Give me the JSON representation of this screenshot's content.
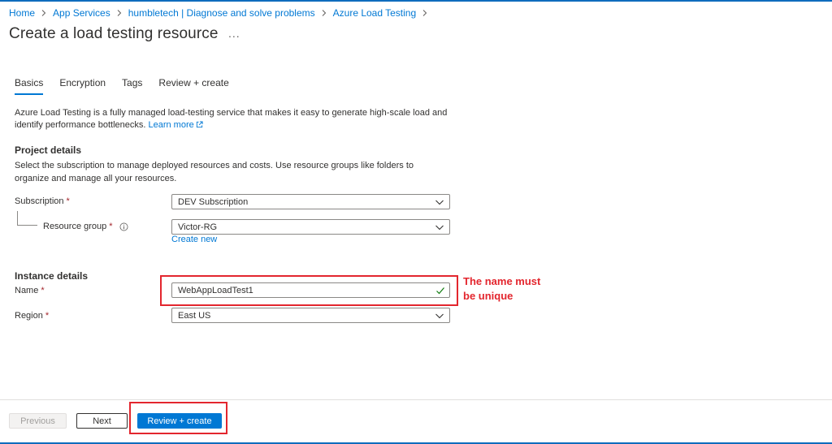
{
  "breadcrumb": [
    {
      "label": "Home"
    },
    {
      "label": "App Services"
    },
    {
      "label": "humbletech | Diagnose and solve problems"
    },
    {
      "label": "Azure Load Testing"
    }
  ],
  "page": {
    "title": "Create a load testing resource",
    "more_label": "..."
  },
  "tabs": [
    {
      "label": "Basics",
      "active": true
    },
    {
      "label": "Encryption",
      "active": false
    },
    {
      "label": "Tags",
      "active": false
    },
    {
      "label": "Review + create",
      "active": false
    }
  ],
  "intro": {
    "text": "Azure Load Testing is a fully managed load-testing service that makes it easy to generate high-scale load and identify performance bottlenecks.",
    "learn_more": "Learn more"
  },
  "project_details": {
    "title": "Project details",
    "description": "Select the subscription to manage deployed resources and costs. Use resource groups like folders to organize and manage all your resources.",
    "subscription": {
      "label": "Subscription",
      "required": "*",
      "value": "DEV Subscription"
    },
    "resource_group": {
      "label": "Resource group",
      "required": "*",
      "value": "Victor-RG",
      "create_new": "Create new"
    }
  },
  "instance_details": {
    "title": "Instance details",
    "name": {
      "label": "Name",
      "required": "*",
      "value": "WebAppLoadTest1"
    },
    "region": {
      "label": "Region",
      "required": "*",
      "value": "East US"
    }
  },
  "annotation": {
    "line1": "The name must",
    "line2": "be unique",
    "color": "#e3262e"
  },
  "footer": {
    "previous": "Previous",
    "next": "Next",
    "review_create": "Review + create"
  },
  "colors": {
    "accent": "#0078d4",
    "required": "#a4262c",
    "valid_check": "#107c10"
  }
}
